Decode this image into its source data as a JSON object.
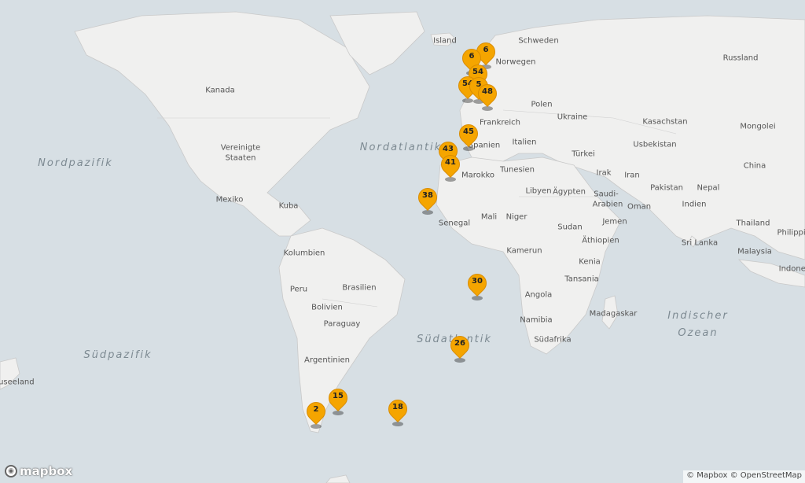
{
  "map": {
    "attribution": "© Mapbox © OpenStreetMap",
    "logo_text": "mapbox",
    "colors": {
      "water": "#d7dfe4",
      "land": "#f0f0ef",
      "marker": "#f5a500",
      "border": "#c9c9c9"
    },
    "ocean_labels": [
      {
        "id": "nordpazifik",
        "text": "Nordpazifik"
      },
      {
        "id": "nordatlantik",
        "text": "Nordatlantik"
      },
      {
        "id": "suedatlantik",
        "text": "Südatlantik"
      },
      {
        "id": "suedpazifik",
        "text": "Südpazifik"
      },
      {
        "id": "indischer-ozean-1",
        "text": "Indischer"
      },
      {
        "id": "indischer-ozean-2",
        "text": "Ozean"
      }
    ],
    "place_labels": [
      "Island",
      "Schweden",
      "Norwegen",
      "Russland",
      "Kanada",
      "Polen",
      "Ukraine",
      "Frankreich",
      "Kasachstan",
      "Mongolei",
      "Italien",
      "Usbekistan",
      "Spanien",
      "Türkei",
      "China",
      "Vereinigte",
      "Staaten",
      "Tunesien",
      "Irak",
      "Iran",
      "Marokko",
      "Libyen",
      "Ägypten",
      "Saudi-",
      "Arabien",
      "Pakistan",
      "Nepal",
      "Mexiko",
      "Kuba",
      "Indien",
      "Oman",
      "Mali",
      "Niger",
      "Senegal",
      "Sudan",
      "Jemen",
      "Philippinen",
      "Thailand",
      "Äthiopien",
      "Sri Lanka",
      "Kamerun",
      "Malaysia",
      "Kolumbien",
      "Kenia",
      "Indonesien",
      "Brasilien",
      "Peru",
      "Tansania",
      "Angola",
      "Bolivien",
      "Namibia",
      "Madagaskar",
      "Paraguay",
      "Südafrika",
      "Argentinien",
      "Neuseeland"
    ],
    "markers": [
      "6",
      "6",
      "54",
      "54",
      "5",
      "48",
      "45",
      "43",
      "41",
      "38",
      "30",
      "26",
      "15",
      "18",
      "2"
    ]
  }
}
